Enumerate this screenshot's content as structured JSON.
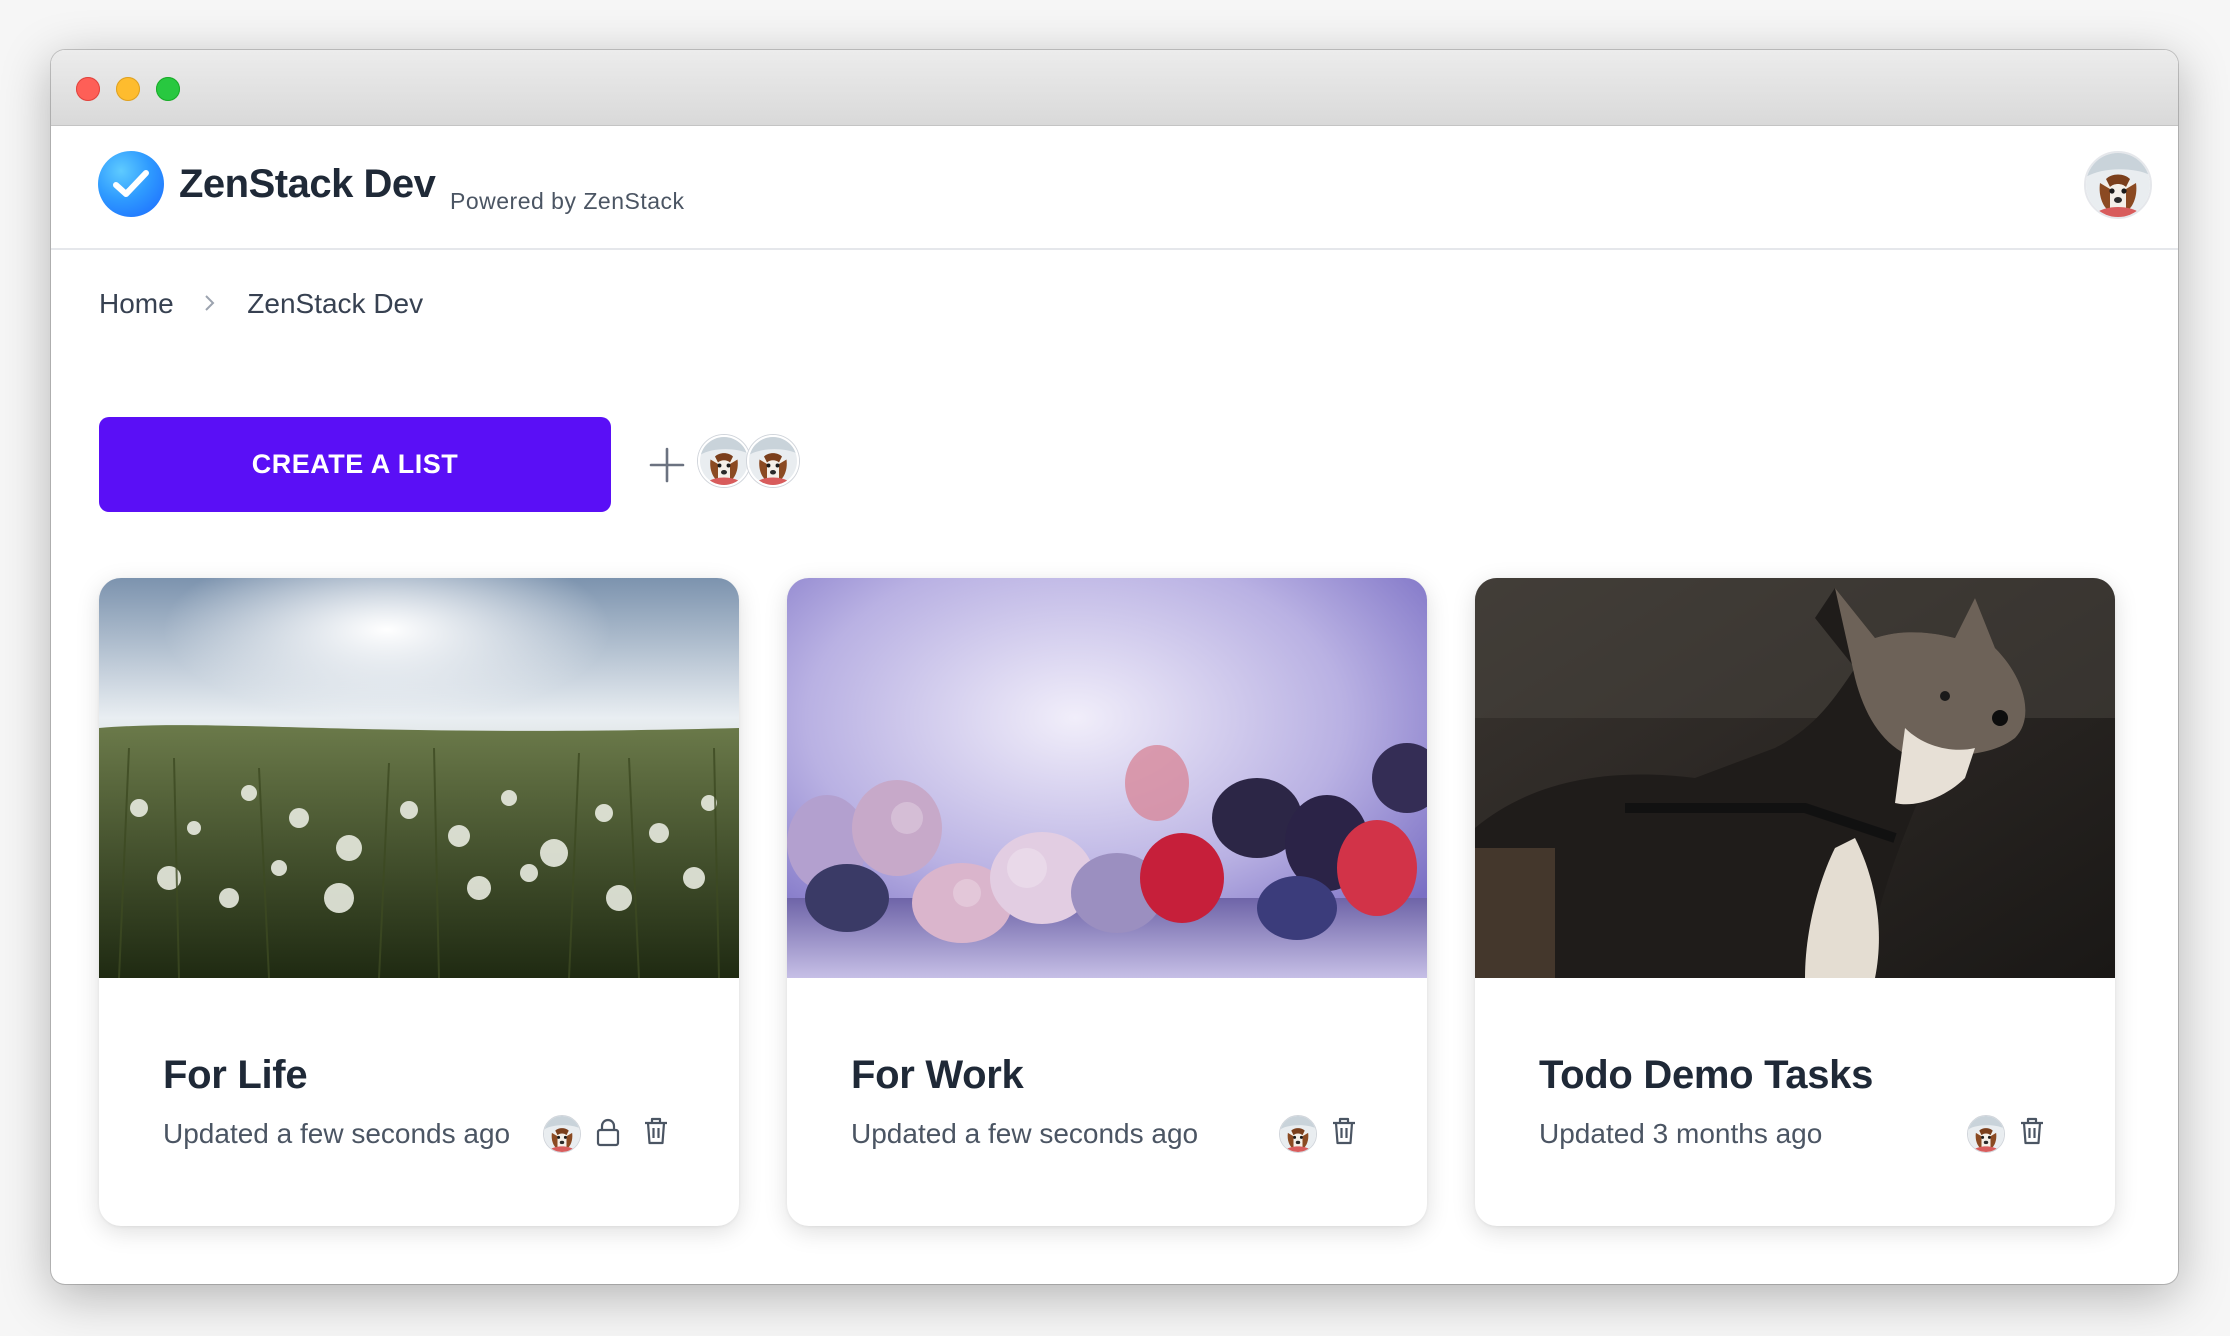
{
  "app": {
    "name": "ZenStack Dev",
    "powered_by": "Powered by ZenStack"
  },
  "breadcrumb": {
    "items": [
      "Home",
      "ZenStack Dev"
    ]
  },
  "actions": {
    "create_label": "CREATE A LIST"
  },
  "colors": {
    "accent": "#5a0ff6",
    "logo": "#2f9bff"
  },
  "lists": [
    {
      "title": "For Life",
      "updated": "Updated a few seconds ago",
      "private": true,
      "image": "dandelion-field"
    },
    {
      "title": "For Work",
      "updated": "Updated a few seconds ago",
      "private": false,
      "image": "frozen-berries"
    },
    {
      "title": "Todo Demo Tasks",
      "updated": "Updated 3 months ago",
      "private": false,
      "image": "husky-dog"
    }
  ],
  "icons": [
    "check-icon",
    "plus-icon",
    "lock-icon",
    "trash-icon",
    "chevron-right-icon"
  ]
}
